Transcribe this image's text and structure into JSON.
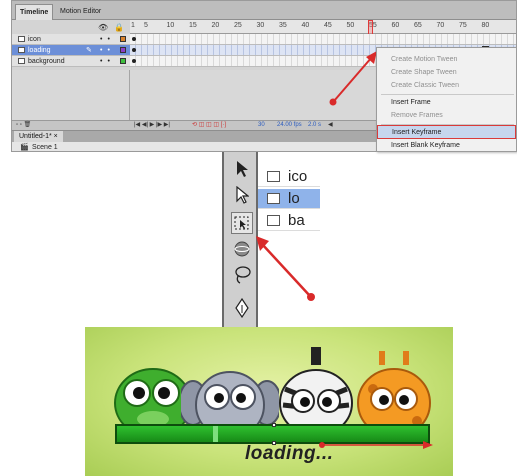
{
  "timeline": {
    "tabs": [
      "Timeline",
      "Motion Editor"
    ],
    "frame_numbers": [
      "1",
      "5",
      "10",
      "15",
      "20",
      "25",
      "30",
      "35",
      "40",
      "45",
      "50",
      "55",
      "60",
      "65",
      "70",
      "75",
      "80"
    ],
    "layers": [
      {
        "name": "icon",
        "color": "#d9822b",
        "selected": false
      },
      {
        "name": "loading",
        "color": "#8a3fc7",
        "selected": true
      },
      {
        "name": "background",
        "color": "#3fbf3f",
        "selected": false
      }
    ],
    "status": {
      "frame": "30",
      "fps": "24.00 fps",
      "time": "2.0 s"
    },
    "document_tab": "Untitled-1* ×",
    "scene_label": "Scene 1"
  },
  "context_menu": {
    "items": [
      {
        "label": "Create Motion Tween",
        "disabled": true
      },
      {
        "label": "Create Shape Tween",
        "disabled": true
      },
      {
        "label": "Create Classic Tween",
        "disabled": true
      },
      {
        "label": "Insert Frame",
        "disabled": false
      },
      {
        "label": "Remove Frames",
        "disabled": true
      },
      {
        "label": "Insert Keyframe",
        "disabled": false,
        "highlighted": true
      },
      {
        "label": "Insert Blank Keyframe",
        "disabled": false
      }
    ]
  },
  "tools_panel": {
    "tools": [
      "selection-tool",
      "subselection-tool",
      "free-transform-tool",
      "3d-rotation-tool",
      "lasso-tool",
      "pen-tool"
    ],
    "selected_tool": "free-transform-tool",
    "layer_labels": [
      "ico",
      "lo",
      "ba"
    ]
  },
  "artwork": {
    "caption": "loading...",
    "characters": [
      "green-monster",
      "grey-elephant",
      "zebra",
      "giraffe"
    ],
    "bar_color": "#23a223",
    "arrow_color": "#d92a2a"
  }
}
